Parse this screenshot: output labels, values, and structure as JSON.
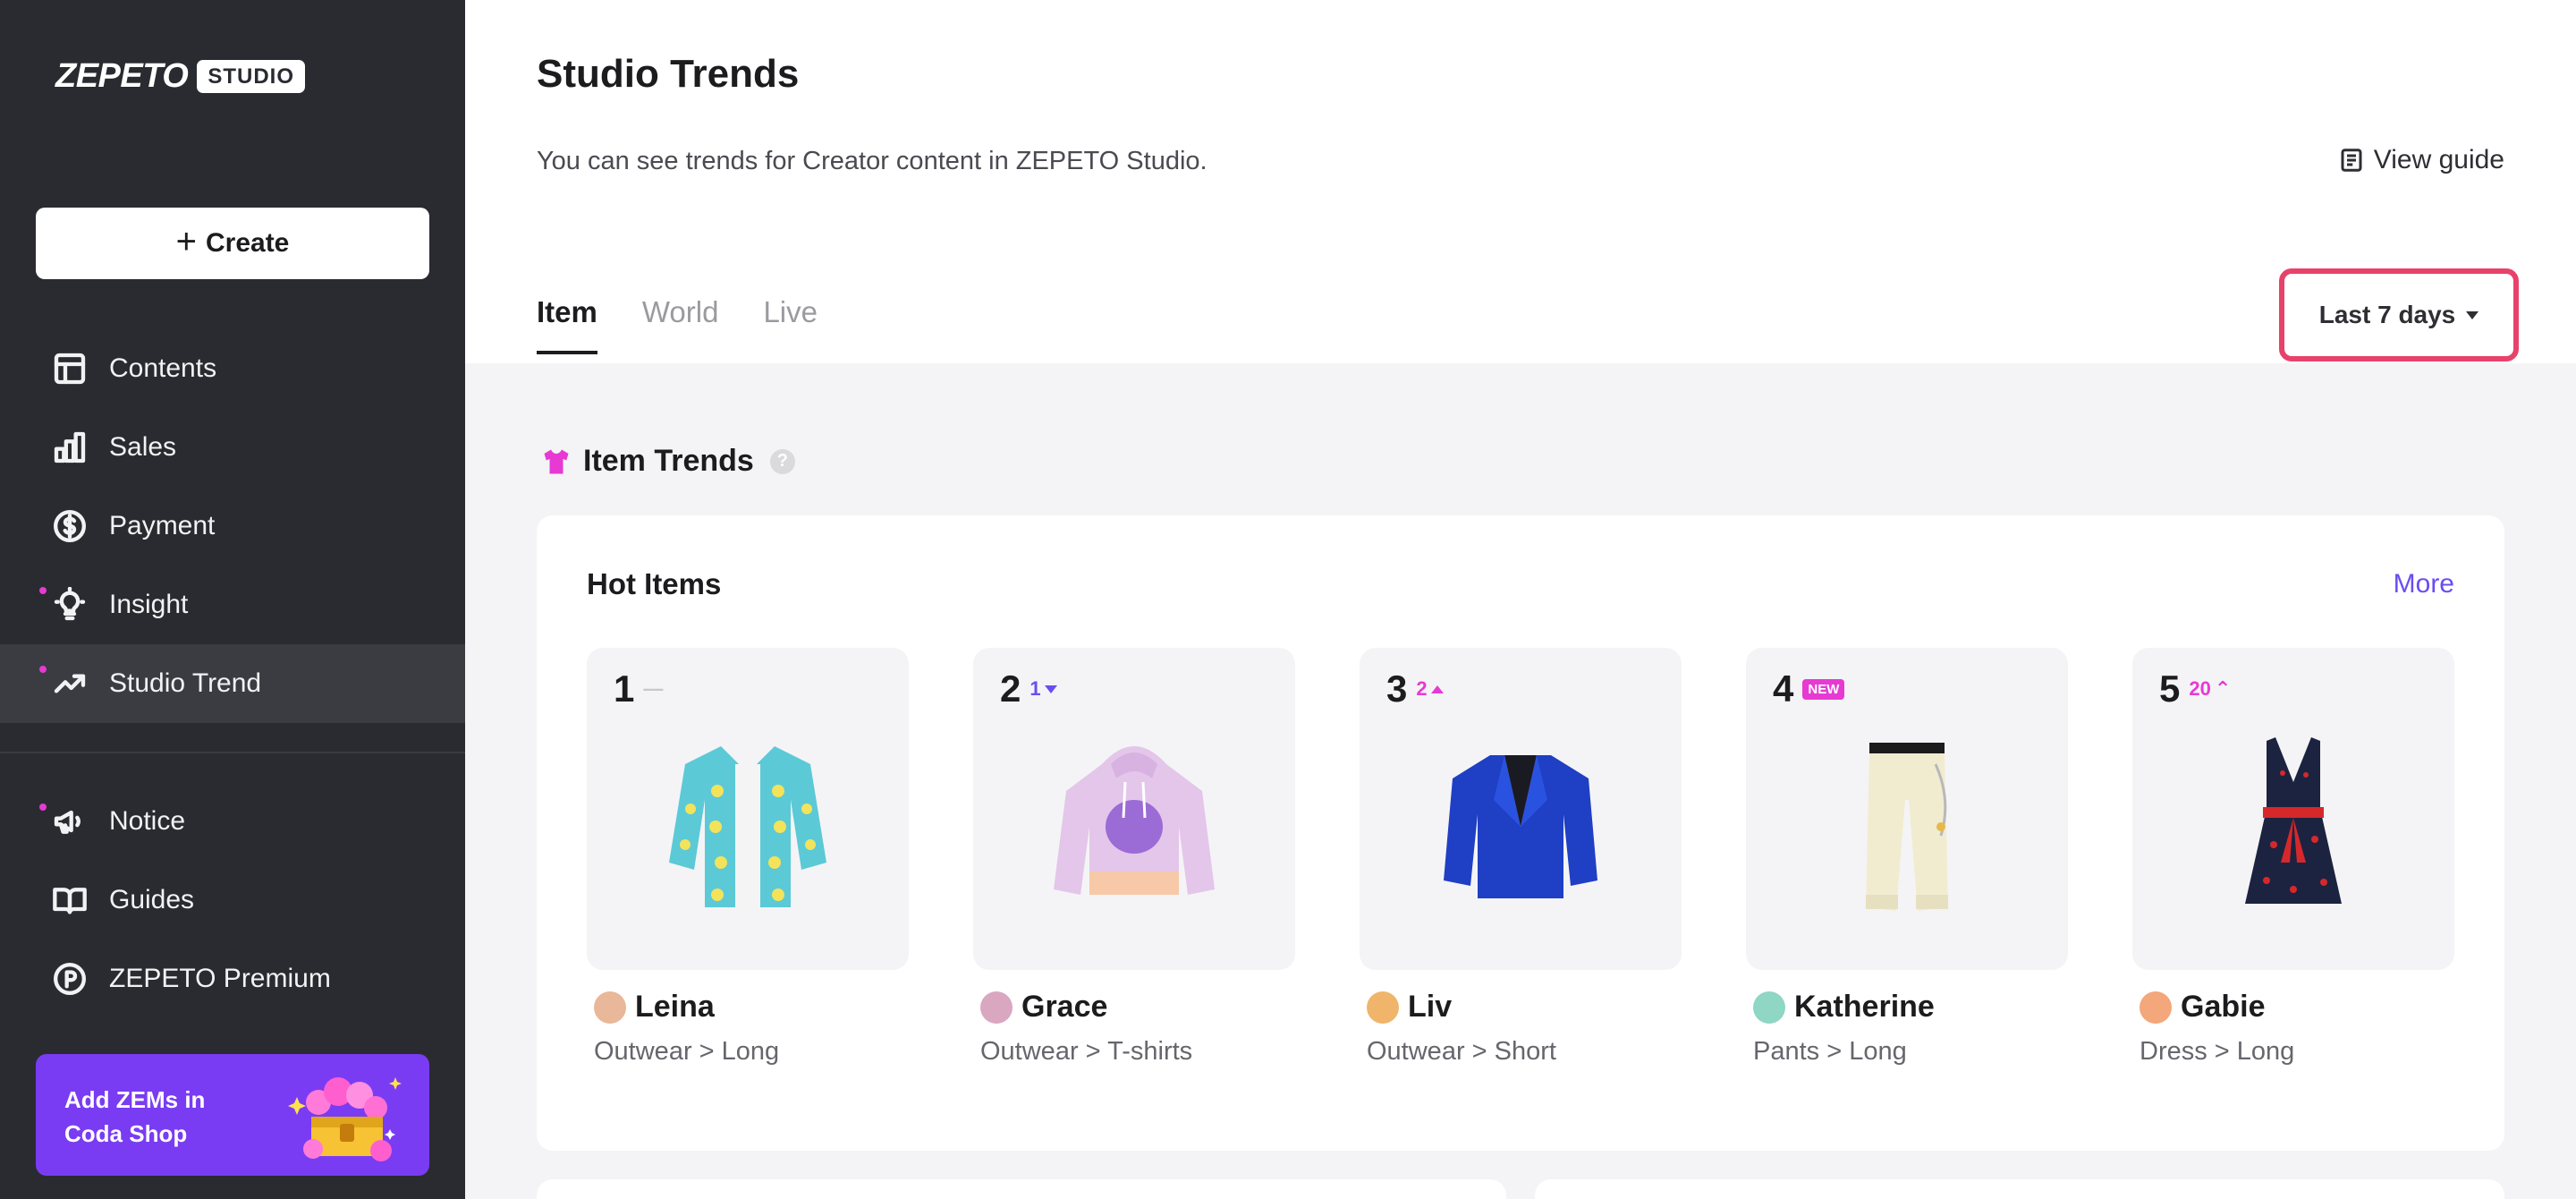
{
  "brand": {
    "word": "ZEPETO",
    "badge": "STUDIO"
  },
  "sidebar": {
    "create_label": "Create",
    "items": [
      {
        "label": "Contents",
        "icon": "layout-icon",
        "dot": false,
        "active": false
      },
      {
        "label": "Sales",
        "icon": "bar-chart-icon",
        "dot": false,
        "active": false
      },
      {
        "label": "Payment",
        "icon": "dollar-circle-icon",
        "dot": false,
        "active": false
      },
      {
        "label": "Insight",
        "icon": "lightbulb-icon",
        "dot": true,
        "active": false
      },
      {
        "label": "Studio Trend",
        "icon": "trend-up-icon",
        "dot": true,
        "active": true
      }
    ],
    "items2": [
      {
        "label": "Notice",
        "icon": "megaphone-icon",
        "dot": true
      },
      {
        "label": "Guides",
        "icon": "book-icon",
        "dot": false
      },
      {
        "label": "ZEPETO Premium",
        "icon": "premium-p-icon",
        "dot": false
      }
    ],
    "promo": {
      "line1": "Add ZEMs in",
      "line2": "Coda Shop"
    }
  },
  "header": {
    "title": "Studio Trends",
    "description": "You can see trends for Creator content in ZEPETO Studio.",
    "view_guide": "View guide"
  },
  "tabs": [
    {
      "label": "Item",
      "active": true
    },
    {
      "label": "World",
      "active": false
    },
    {
      "label": "Live",
      "active": false
    }
  ],
  "period": {
    "selected": "Last 7 days"
  },
  "section": {
    "title": "Item Trends"
  },
  "hot_items": {
    "title": "Hot Items",
    "more": "More",
    "items": [
      {
        "rank": "1",
        "change": "—",
        "change_type": "same",
        "creator": "Leina",
        "category": "Outwear > Long",
        "avatar_color": "#e9b79a",
        "art": "shirt"
      },
      {
        "rank": "2",
        "change": "1",
        "change_type": "down",
        "creator": "Grace",
        "category": "Outwear > T-shirts",
        "avatar_color": "#d9a7c0",
        "art": "hoodie"
      },
      {
        "rank": "3",
        "change": "2",
        "change_type": "up",
        "creator": "Liv",
        "category": "Outwear > Short",
        "avatar_color": "#f0b56a",
        "art": "blazer"
      },
      {
        "rank": "4",
        "change": "NEW",
        "change_type": "new",
        "creator": "Katherine",
        "category": "Pants > Long",
        "avatar_color": "#8fd6c4",
        "art": "pants"
      },
      {
        "rank": "5",
        "change": "20",
        "change_type": "jump",
        "creator": "Gabie",
        "category": "Dress > Long",
        "avatar_color": "#f3a77a",
        "art": "dress"
      }
    ]
  },
  "colors": {
    "sidebar_bg": "#2a2b30",
    "accent_purple": "#6b4cf2",
    "accent_pink": "#e63ad3",
    "highlight": "#e8426a",
    "promo_bg": "#7a3cf2"
  }
}
